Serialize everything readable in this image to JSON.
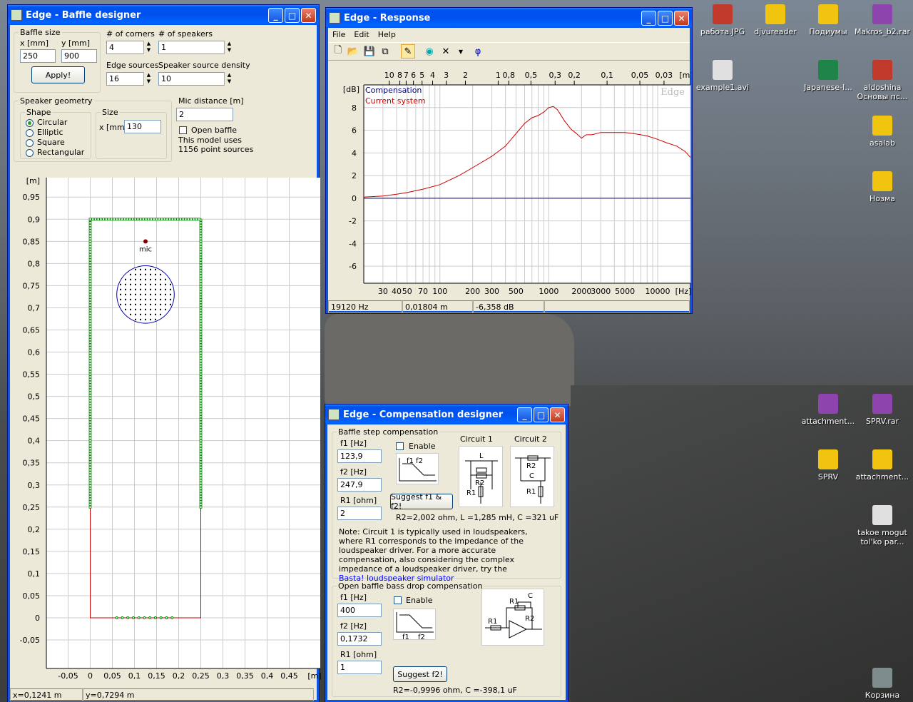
{
  "desktop": {
    "icons": [
      {
        "label": "работа.JPG",
        "color": "#c0392b"
      },
      {
        "label": "djvureader",
        "color": "#f1c40f"
      },
      {
        "label": "Подиумы",
        "color": "#f1c40f"
      },
      {
        "label": "Makros_b2.rar",
        "color": "#8e44ad"
      },
      {
        "label": "example1.avi",
        "color": "#e0e0e0"
      },
      {
        "label": "Japanese-I...",
        "color": "#1e8449"
      },
      {
        "label": "aldoshina Основы пс...",
        "color": "#c0392b"
      },
      {
        "label": "asalab",
        "color": "#f1c40f"
      },
      {
        "label": "Нозма",
        "color": "#f1c40f"
      },
      {
        "label": "attachment...",
        "color": "#8e44ad"
      },
      {
        "label": "SPRV.rar",
        "color": "#8e44ad"
      },
      {
        "label": "SPRV",
        "color": "#f1c40f"
      },
      {
        "label": "attachment...",
        "color": "#f1c40f"
      },
      {
        "label": "takoe mogut tol'ko par...",
        "color": "#e0e0e0"
      },
      {
        "label": "Корзина",
        "color": "#7f8c8d"
      }
    ]
  },
  "baffle": {
    "title": "Edge - Baffle designer",
    "baffle_size": "Baffle size",
    "x_label": "x [mm]",
    "y_label": "y [mm]",
    "x_val": "250",
    "y_val": "900",
    "apply": "Apply!",
    "corners_label": "# of corners",
    "corners_val": "4",
    "speakers_label": "# of speakers",
    "speakers_val": "1",
    "edge_label": "Edge sources",
    "edge_val": "16",
    "density_label": "Speaker source density",
    "density_val": "10",
    "geom": "Speaker geometry",
    "shape": "Shape",
    "shapes": [
      "Circular",
      "Elliptic",
      "Square",
      "Rectangular"
    ],
    "size": "Size",
    "size_x_label": "x [mm]",
    "size_x_val": "130",
    "mic_label": "Mic distance [m]",
    "mic_val": "2",
    "open_baffle": "Open baffle",
    "model_note1": "This model uses",
    "model_note2": "1156 point sources",
    "plot": {
      "y_unit": "[m]",
      "x_unit": "[m]",
      "mic": "mic",
      "y_ticks": [
        "0,95",
        "0,9",
        "0,85",
        "0,8",
        "0,75",
        "0,7",
        "0,65",
        "0,6",
        "0,55",
        "0,5",
        "0,45",
        "0,4",
        "0,35",
        "0,3",
        "0,25",
        "0,2",
        "0,15",
        "0,1",
        "0,05",
        "0",
        "-0,05"
      ],
      "x_ticks": [
        "-0,05",
        "0",
        "0,05",
        "0,1",
        "0,15",
        "0,2",
        "0,25",
        "0,3",
        "0,35",
        "0,4",
        "0,45"
      ]
    },
    "status_x": "x=0,1241 m",
    "status_y": "y=0,7294 m"
  },
  "response": {
    "title": "Edge - Response",
    "menu": [
      "File",
      "Edit",
      "Help"
    ],
    "tools": [
      "new-icon",
      "open-icon",
      "save-icon",
      "copy-icon",
      "pen-icon",
      "speaker-icon",
      "clear-icon",
      "phase-icon"
    ],
    "phase_glyph": "φ",
    "watermark": "Edge",
    "status": [
      "19120 Hz",
      "0,01804 m",
      "-6,358 dB"
    ]
  },
  "comp": {
    "title": "Edge - Compensation designer",
    "bsc": "Baffle step compensation",
    "f1": "f1 [Hz]",
    "f1_val": "123,9",
    "f2": "f2 [Hz]",
    "f2_val": "247,9",
    "r1": "R1 [ohm]",
    "r1_val": "2",
    "enable": "Enable",
    "f1f2": "f1 f2",
    "circuit1": "Circuit 1",
    "circuit2": "Circuit 2",
    "suggest": "Suggest f1 & f2!",
    "result": "R2=2,002 ohm, L =1,285 mH, C =321 uF",
    "note": "Note: Circuit 1 is typically used in loudspeakers, where R1 corresponds to the impedance of the loudspeaker driver. For a more accurate compensation, also considering the complex impedance of a loudspeaker driver, try the",
    "link": "Basta! loudspeaker simulator",
    "obc": "Open baffle bass drop compensation",
    "f1b_val": "400",
    "f2b_val": "0,1732",
    "r1b_val": "1",
    "enable2": "Enable",
    "f1b": "f1",
    "f2b": "f2",
    "suggest2": "Suggest f2!",
    "result2": "R2=-0,9996 ohm, C =-398,1 uF",
    "c1_labels": [
      "L",
      "R2",
      "R1"
    ],
    "c2_labels": [
      "R2",
      "C",
      "R1"
    ],
    "c3_labels": [
      "C",
      "R1",
      "R2",
      "R1"
    ]
  },
  "chart_data": {
    "type": "line",
    "xscale": "log",
    "xlim": [
      20,
      20000
    ],
    "ylim": [
      -7.5,
      10
    ],
    "x_ticks": [
      {
        "v": 30,
        "t": "30"
      },
      {
        "v": 40,
        "t": "40"
      },
      {
        "v": 50,
        "t": "50"
      },
      {
        "v": 70,
        "t": "70"
      },
      {
        "v": 100,
        "t": "100"
      },
      {
        "v": 200,
        "t": "200"
      },
      {
        "v": 300,
        "t": "300"
      },
      {
        "v": 500,
        "t": "500"
      },
      {
        "v": 1000,
        "t": "1000"
      },
      {
        "v": 2000,
        "t": "2000"
      },
      {
        "v": 3000,
        "t": "3000"
      },
      {
        "v": 5000,
        "t": "5000"
      },
      {
        "v": 10000,
        "t": "10000"
      }
    ],
    "x_unit": "[Hz]",
    "top_ticks": [
      {
        "v": 10,
        "t": "10"
      },
      {
        "v": 8,
        "t": "8"
      },
      {
        "v": 7,
        "t": "7"
      },
      {
        "v": 6,
        "t": "6"
      },
      {
        "v": 5,
        "t": "5"
      },
      {
        "v": 4,
        "t": "4"
      },
      {
        "v": 3,
        "t": "3"
      },
      {
        "v": 2,
        "t": "2"
      },
      {
        "v": 1,
        "t": "1"
      },
      {
        "v": 0.8,
        "t": "0,8"
      },
      {
        "v": 0.5,
        "t": "0,5"
      },
      {
        "v": 0.3,
        "t": "0,3"
      },
      {
        "v": 0.2,
        "t": "0,2"
      },
      {
        "v": 0.1,
        "t": "0,1"
      },
      {
        "v": 0.05,
        "t": "0,05"
      },
      {
        "v": 0.03,
        "t": "0,03"
      }
    ],
    "top_unit": "[m]",
    "y_ticks": [
      8,
      6,
      4,
      2,
      0,
      -2,
      -4,
      -6
    ],
    "y_unit": "[dB]",
    "series": [
      {
        "name": "Compensation",
        "color": "#000080",
        "x": [
          20,
          20000
        ],
        "y": [
          0,
          0
        ]
      },
      {
        "name": "Current system",
        "color": "#cc0000",
        "x": [
          20,
          30,
          40,
          50,
          70,
          100,
          150,
          200,
          300,
          400,
          500,
          600,
          700,
          800,
          900,
          1000,
          1100,
          1200,
          1400,
          1600,
          1800,
          2000,
          2200,
          2500,
          3000,
          4000,
          5000,
          6000,
          7000,
          8000,
          10000,
          12000,
          15000,
          18000,
          20000
        ],
        "y": [
          0.1,
          0.2,
          0.35,
          0.5,
          0.8,
          1.2,
          2.0,
          2.7,
          3.7,
          4.6,
          5.7,
          6.6,
          7.1,
          7.3,
          7.6,
          8.0,
          8.1,
          7.8,
          6.8,
          6.1,
          5.7,
          5.3,
          5.6,
          5.6,
          5.8,
          5.8,
          5.8,
          5.7,
          5.6,
          5.5,
          5.2,
          4.9,
          4.6,
          4.1,
          3.6
        ]
      }
    ]
  }
}
